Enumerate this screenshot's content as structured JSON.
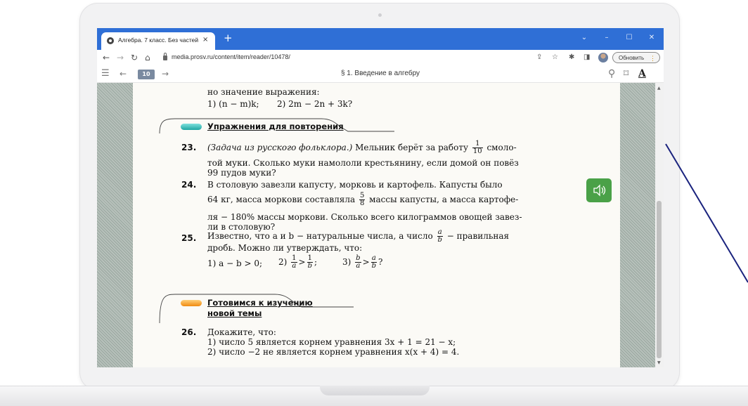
{
  "browser": {
    "tab_title": "Алгебра. 7 класс. Без частей",
    "tab_close": "×",
    "new_tab": "+",
    "url": "media.prosv.ru/content/item/reader/10478/",
    "update_button": "Обновить",
    "update_menu": "⋮",
    "window_controls": [
      "⌄",
      "–",
      "☐",
      "✕"
    ]
  },
  "reader": {
    "page_number": "10",
    "section_title": "§ 1. Введение в алгебру"
  },
  "book": {
    "prev_line_1": "но значение выражения:",
    "prev_line_2a": "1) (n − m)k;",
    "prev_line_2b": "2) 2m − 2n + 3k?",
    "heading_review": "Упражнения для повторения",
    "ex23": {
      "number": "23.",
      "line1_italic": "(Задача из русского фольклора.)",
      "line1_rest": " Мельник берёт за работу",
      "line1_frac_num": "1",
      "line1_frac_den": "10",
      "line1_end": "смоло-",
      "line2": "той муки. Сколько муки намололи крестьянину, если домой он повёз",
      "line3": "99 пудов муки?"
    },
    "ex24": {
      "number": "24.",
      "line1": "В столовую завезли капусту, морковь и картофель. Капусты было",
      "line2a": "64 кг, масса моркови составляла",
      "line2_frac_num": "5",
      "line2_frac_den": "8",
      "line2b": "массы капусты, а масса картофе-",
      "line3": "ля − 180% массы моркови. Сколько всего килограммов овощей завез-",
      "line4": "ли в столовую?"
    },
    "ex25": {
      "number": "25.",
      "line1a": "Известно, что a и b − натуральные числа, а число",
      "line1_frac_num": "a",
      "line1_frac_den": "b",
      "line1b": "− правильная",
      "line2": "дробь. Можно ли утверждать, что:",
      "opt1": "1) a − b > 0;",
      "opt2_pre": "2)",
      "opt2_f1_num": "1",
      "opt2_f1_den": "a",
      "opt2_mid": ">",
      "opt2_f2_num": "1",
      "opt2_f2_den": "b",
      "opt2_end": ";",
      "opt3_pre": "3)",
      "opt3_f1_num": "b",
      "opt3_f1_den": "a",
      "opt3_mid": ">",
      "opt3_f2_num": "a",
      "opt3_f2_den": "b",
      "opt3_end": "?"
    },
    "heading_prepare_1": "Готовимся к изучению",
    "heading_prepare_2": "новой темы",
    "ex26": {
      "number": "26.",
      "line1": "Докажите, что:",
      "line2": "1) число 5 является корнем уравнения 3x + 1 = 21 − x;",
      "line3": "2) число −2 не является корнем уравнения x(x + 4) = 4."
    }
  },
  "colors": {
    "chrome_blue": "#2f6fd6",
    "review_pill": "#2bb3b0",
    "prepare_pill": "#f0a020",
    "audio_green": "#4aa148",
    "pointer_line": "#1a237e"
  },
  "icons": [
    "menu-icon",
    "back-arrow-icon",
    "forward-arrow-icon",
    "search-icon",
    "bookmark-icon",
    "font-size-icon",
    "audio-icon",
    "chat-icon"
  ]
}
